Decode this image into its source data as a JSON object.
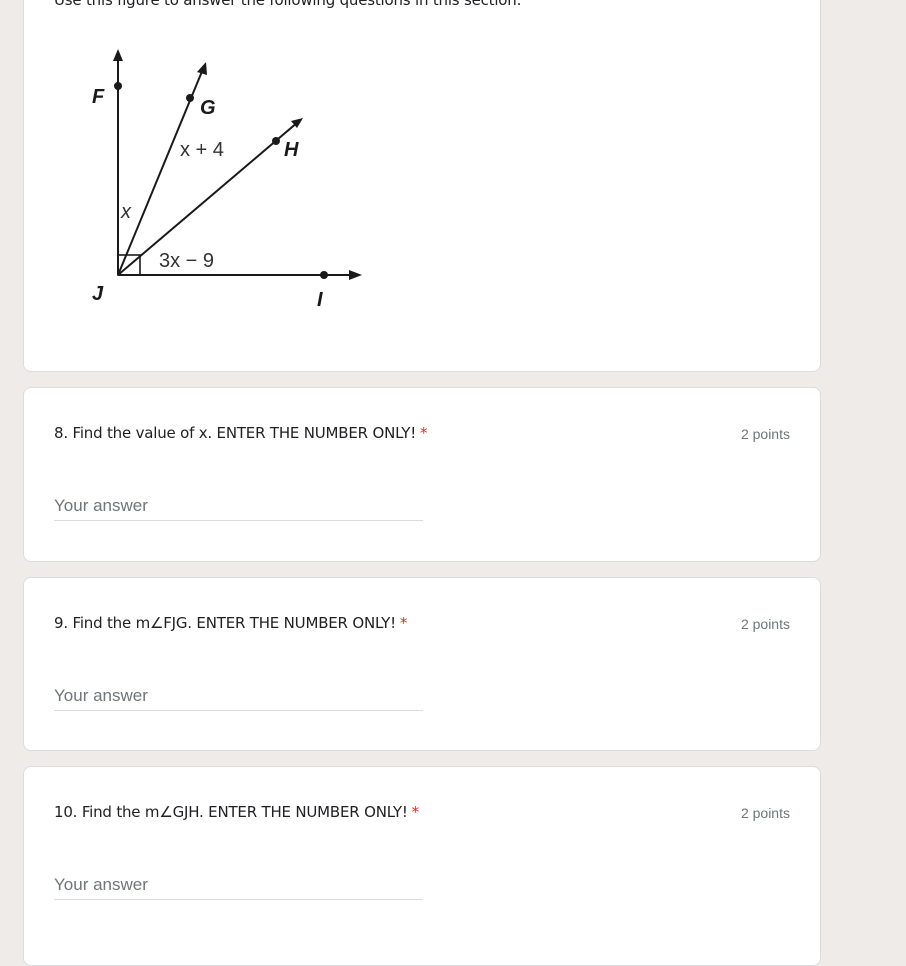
{
  "section": {
    "description": "Use this figure to answer the following questions in this section.",
    "figure": {
      "point_labels": [
        "F",
        "G",
        "H",
        "J",
        "I"
      ],
      "angle_labels": [
        "x",
        "x + 4",
        "3x − 9"
      ]
    }
  },
  "questions": [
    {
      "title": "8. Find the value of x. ENTER THE NUMBER ONLY!",
      "required_mark": "*",
      "points": "2 points",
      "placeholder": "Your answer"
    },
    {
      "title": "9. Find the m∠FJG. ENTER THE NUMBER ONLY!",
      "required_mark": "*",
      "points": "2 points",
      "placeholder": "Your answer"
    },
    {
      "title": "10. Find the m∠GJH. ENTER THE NUMBER ONLY!",
      "required_mark": "*",
      "points": "2 points",
      "placeholder": "Your answer"
    }
  ],
  "colors": {
    "background": "#efebe8",
    "required": "#d93025",
    "muted_text": "#70757a"
  }
}
